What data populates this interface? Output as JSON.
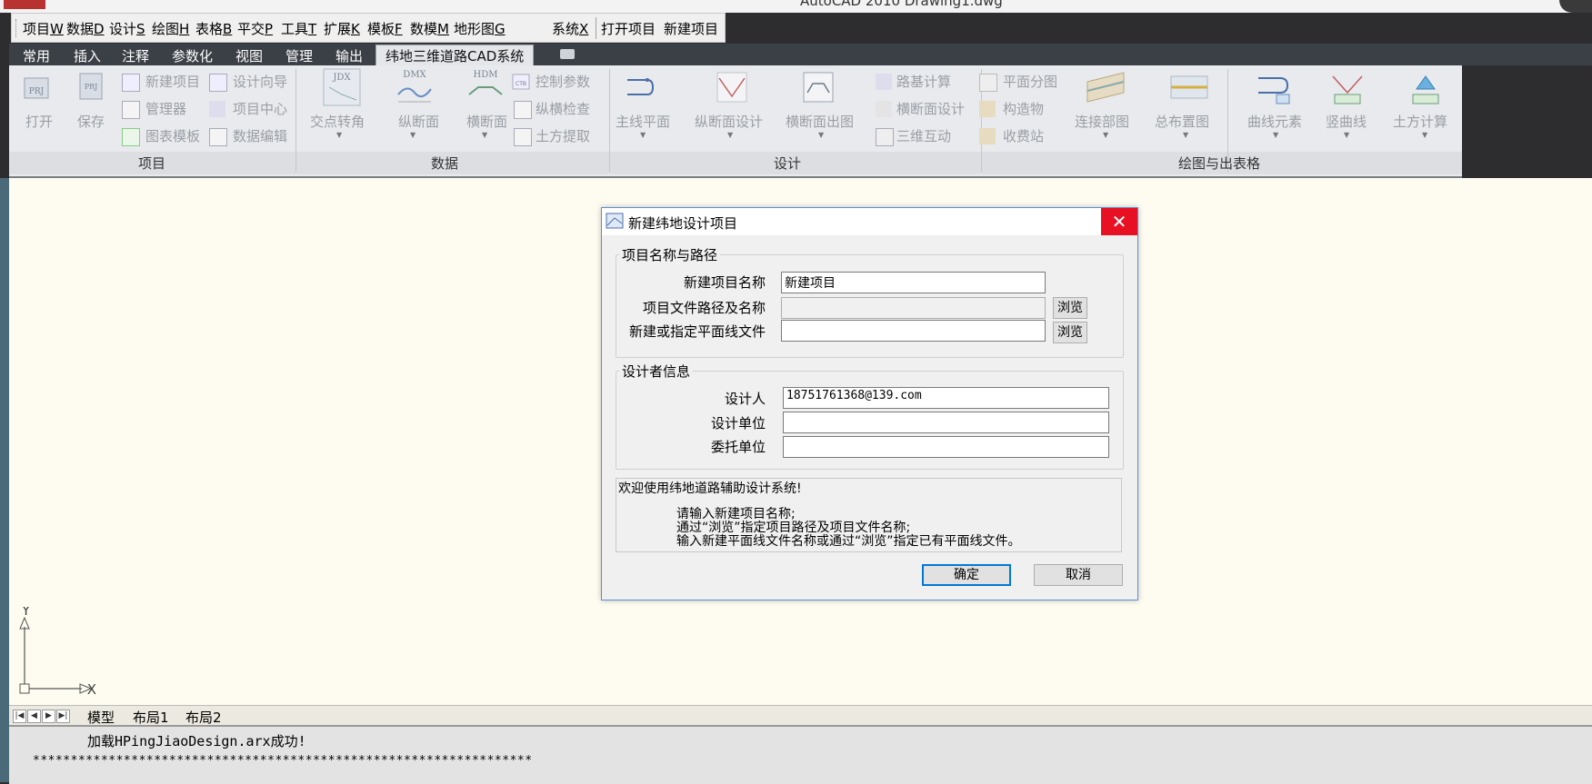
{
  "window": {
    "title": "AutoCAD 2010    Drawing1.dwg"
  },
  "menubar": {
    "items": [
      {
        "label": "项目",
        "key": "W"
      },
      {
        "label": "数据",
        "key": "D"
      },
      {
        "label": "设计",
        "key": "S"
      },
      {
        "label": "绘图",
        "key": "H"
      },
      {
        "label": "表格",
        "key": "B"
      },
      {
        "label": "平交",
        "key": "P"
      },
      {
        "label": "工具",
        "key": "T"
      },
      {
        "label": "扩展",
        "key": "K"
      },
      {
        "label": "模板",
        "key": "F"
      },
      {
        "label": "数模",
        "key": "M"
      },
      {
        "label": "地形图",
        "key": "G"
      },
      {
        "label": "系统",
        "key": "X"
      }
    ],
    "quick": [
      "打开项目",
      "新建项目"
    ]
  },
  "ribbon_tabs": [
    "常用",
    "插入",
    "注释",
    "参数化",
    "视图",
    "管理",
    "输出",
    "纬地三维道路CAD系统"
  ],
  "ribbon": {
    "groups": [
      "项目",
      "数据",
      "设计",
      "绘图与出表格"
    ],
    "project": {
      "open": "打开",
      "save": "保存",
      "new_project": "新建项目",
      "manager": "管理器",
      "chart_template": "图表模板",
      "design_wizard": "设计向导",
      "project_center": "项目中心",
      "data_edit": "数据编辑"
    },
    "data": {
      "jdx_icon_text": "JDX",
      "dmx_icon_text": "DMX",
      "hdm_icon_text": "HDM",
      "jdx": "交点转角",
      "dmx": "纵断面",
      "hdm": "横断面",
      "ctrl_params": "控制参数",
      "ctb_icon_text": "CTB",
      "check": "纵横检查",
      "earth_extract": "土方提取"
    },
    "design": {
      "main_plane": "主线平面",
      "profile_design": "纵断面设计",
      "cross_output": "横断面出图",
      "subgrade_calc": "路基计算",
      "cross_design": "横断面设计",
      "3d_interact": "三维互动"
    },
    "drawing": {
      "plan_split": "平面分图",
      "structure": "构造物",
      "toll_station": "收费站",
      "connect_map": "连接部图",
      "layout_map": "总布置图",
      "curve_elements": "曲线元素",
      "vertical_curve": "竖曲线",
      "earthwork": "土方计算"
    }
  },
  "layout_tabs": [
    "模型",
    "布局1",
    "布局2"
  ],
  "command_line": {
    "line1": "加载HPingJiaoDesign.arx成功!",
    "line2": "******************************************************************"
  },
  "dialog": {
    "title": "新建纬地设计项目",
    "section1": "项目名称与路径",
    "name_label": "新建项目名称",
    "name_value": "新建项目",
    "path_label": "项目文件路径及名称",
    "path_value": "",
    "plan_label": "新建或指定平面线文件",
    "plan_value": "",
    "browse": "浏览",
    "section2": "设计者信息",
    "designer_label": "设计人",
    "designer_value": "18751761368@139.com",
    "unit_label": "设计单位",
    "unit_value": "",
    "client_label": "委托单位",
    "client_value": "",
    "message": [
      "欢迎使用纬地道路辅助设计系统!",
      "请输入新建项目名称;",
      "通过“浏览”指定项目路径及项目文件名称;",
      "输入新建平面线文件名称或通过“浏览”指定已有平面线文件。"
    ],
    "ok": "确定",
    "cancel": "取消"
  },
  "ucs": {
    "x": "X",
    "y": "Y"
  }
}
